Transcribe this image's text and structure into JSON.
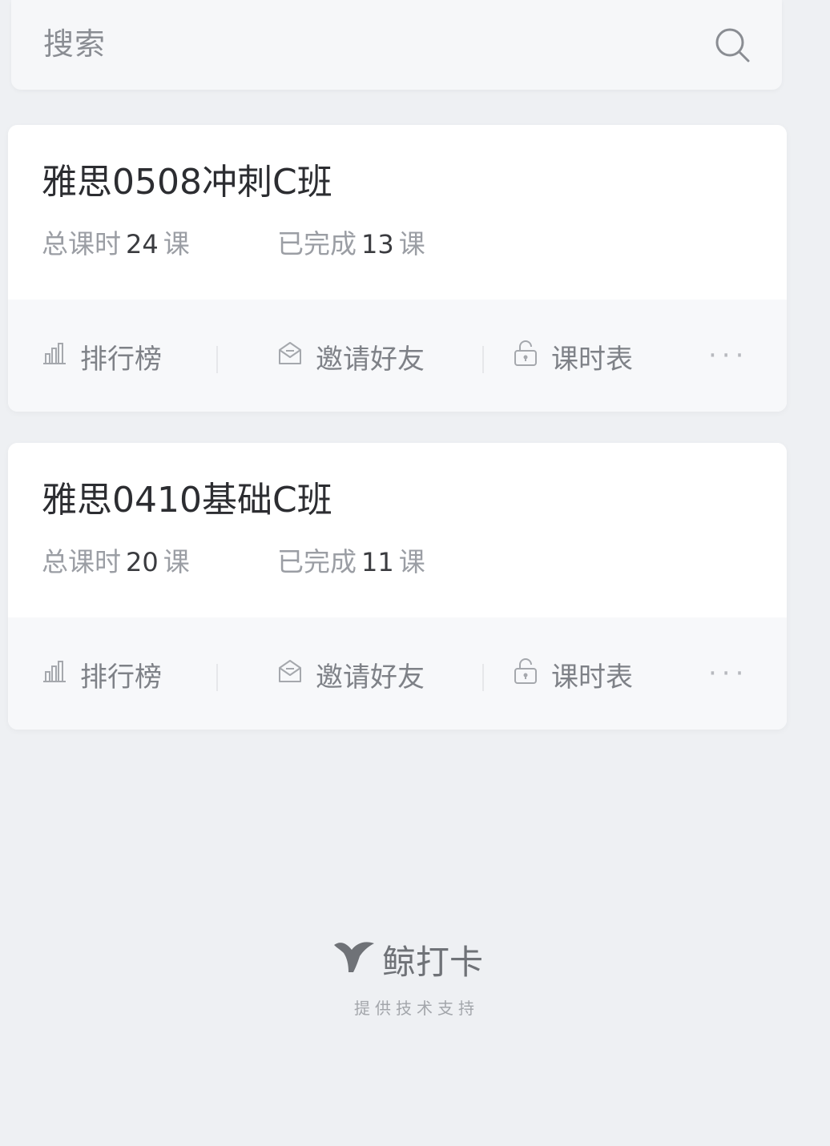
{
  "search": {
    "placeholder": "搜索"
  },
  "classes": [
    {
      "title": "雅思0508冲刺C班",
      "total_prefix": "总课时",
      "total": "24",
      "total_unit": "课",
      "done_prefix": "已完成",
      "done": "13",
      "done_unit": "课",
      "actions": {
        "rank": "排行榜",
        "invite": "邀请好友",
        "schedule": "课时表",
        "more": "···"
      }
    },
    {
      "title": "雅思0410基础C班",
      "total_prefix": "总课时",
      "total": "20",
      "total_unit": "课",
      "done_prefix": "已完成",
      "done": "11",
      "done_unit": "课",
      "actions": {
        "rank": "排行榜",
        "invite": "邀请好友",
        "schedule": "课时表",
        "more": "···"
      }
    }
  ],
  "footer": {
    "brand": "鲸打卡",
    "subtitle": "提供技术支持"
  },
  "icons": {
    "search": "search-icon",
    "rank": "bar-chart-icon",
    "invite": "envelope-icon",
    "schedule": "lock-icon",
    "brand": "whale-tail-icon"
  },
  "colors": {
    "background": "#eef0f3",
    "card": "#ffffff",
    "action_bar": "#f7f8fa",
    "title_text": "#2c2d31",
    "muted_text": "#9b9ea4"
  }
}
